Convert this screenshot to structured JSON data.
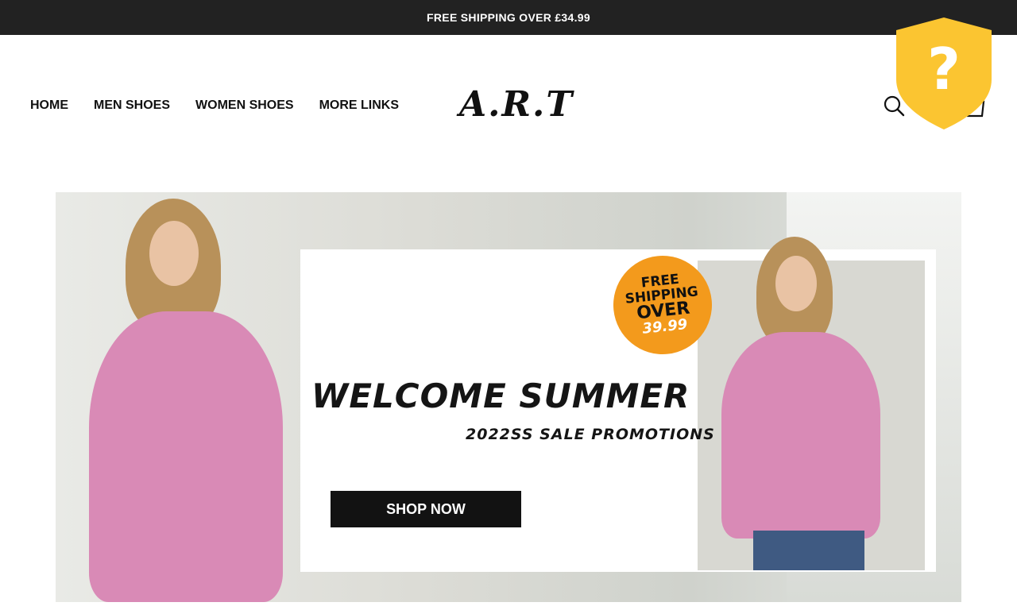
{
  "announcement": {
    "text": "FREE SHIPPING OVER  £34.99"
  },
  "nav": {
    "items": [
      "HOME",
      "MEN SHOES",
      "WOMEN SHOES",
      "MORE LINKS"
    ]
  },
  "logo": {
    "text": "A.R.T"
  },
  "icons": {
    "search": "search-icon",
    "cart": "cart-icon",
    "badge": "shield-question-icon"
  },
  "badge": {
    "symbol": "?"
  },
  "banner": {
    "free_ship_line1": "FREE",
    "free_ship_line2": "SHIPPING",
    "free_ship_line3": "OVER",
    "free_ship_amount": "39.99",
    "title": "WELCOME SUMMER",
    "subtitle": "2022SS SALE PROMOTIONS",
    "button_label": "SHOP NOW"
  },
  "colors": {
    "topbar": "#222222",
    "badge": "#fbc531",
    "shirt": "#d98ab6",
    "free_ship_circle": "#f39a1c",
    "shop_button": "#121212"
  }
}
